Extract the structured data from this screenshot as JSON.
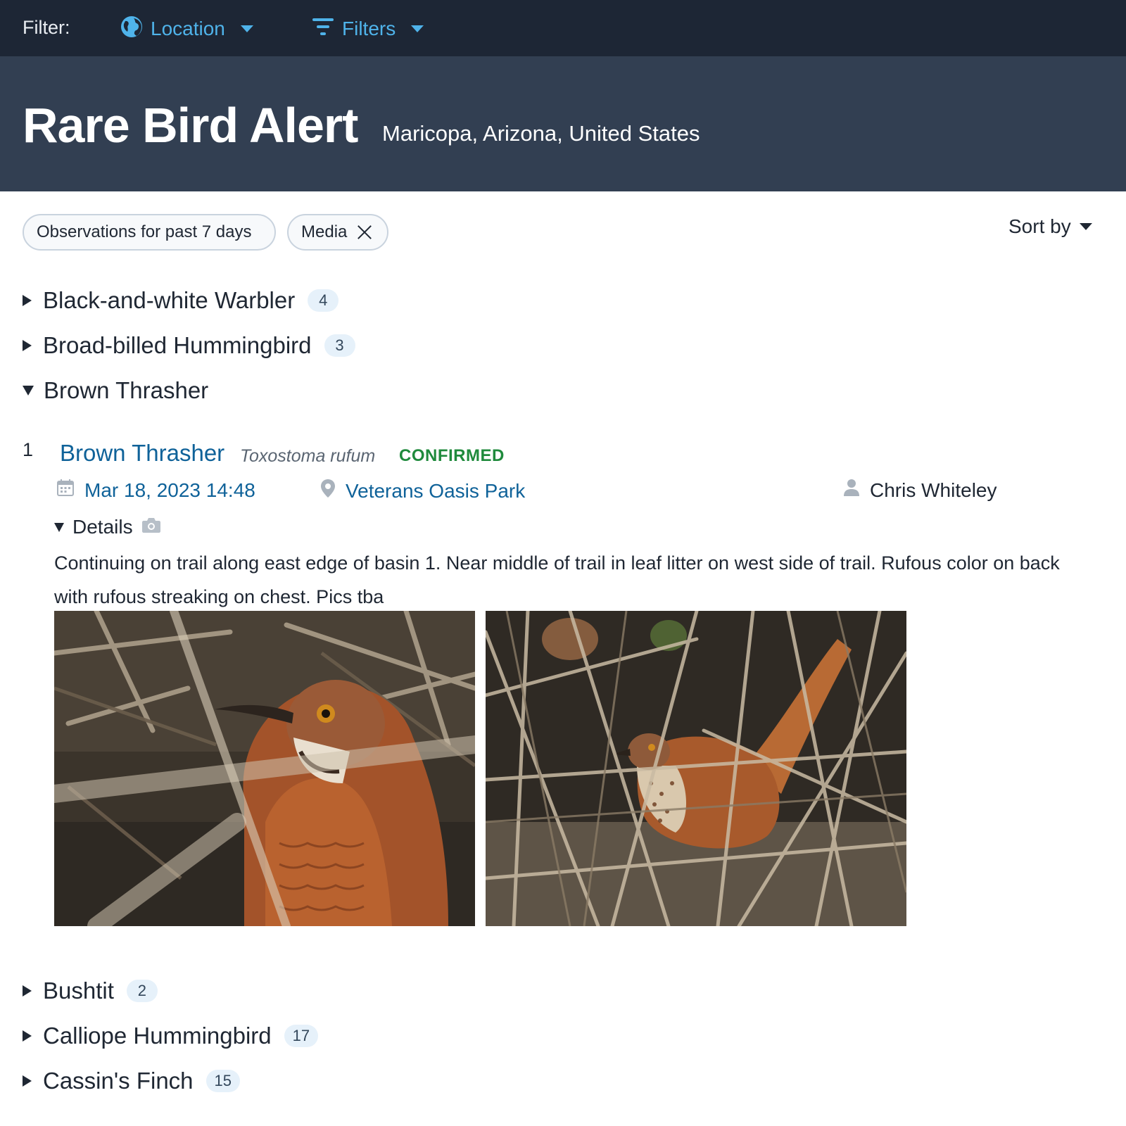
{
  "topbar": {
    "filter_label": "Filter:",
    "location_label": "Location",
    "filters_label": "Filters"
  },
  "header": {
    "title": "Rare Bird Alert",
    "subtitle": "Maricopa, Arizona, United States"
  },
  "chips": {
    "observations": "Observations for past 7 days",
    "media": "Media"
  },
  "sort": {
    "label": "Sort by"
  },
  "species_list": [
    {
      "name": "Black-and-white Warbler",
      "count": "4",
      "expanded": false
    },
    {
      "name": "Broad-billed Hummingbird",
      "count": "3",
      "expanded": false
    },
    {
      "name": "Brown Thrasher",
      "count": "",
      "expanded": true
    },
    {
      "name": "Bushtit",
      "count": "2",
      "expanded": false
    },
    {
      "name": "Calliope Hummingbird",
      "count": "17",
      "expanded": false
    },
    {
      "name": "Cassin's Finch",
      "count": "15",
      "expanded": false
    }
  ],
  "observation": {
    "number": "1",
    "common_name": "Brown Thrasher",
    "scientific_name": "Toxostoma rufum",
    "status": "CONFIRMED",
    "date": "Mar 18, 2023 14:48",
    "location": "Veterans Oasis Park",
    "observer": "Chris Whiteley",
    "details_label": "Details",
    "text": "Continuing on trail along east edge of basin 1. Near middle of trail in leaf litter on west side of trail. Rufous color on back with rufous streaking on chest. Pics tba"
  },
  "colors": {
    "topbar_bg": "#1d2635",
    "header_bg": "#323f52",
    "link": "#0f6299",
    "accent": "#4fb3ea",
    "confirmed": "#1f8a3c"
  },
  "icons": [
    "globe-icon",
    "filter-icon",
    "close-icon",
    "calendar-icon",
    "location-pin-icon",
    "person-icon",
    "camera-icon"
  ]
}
